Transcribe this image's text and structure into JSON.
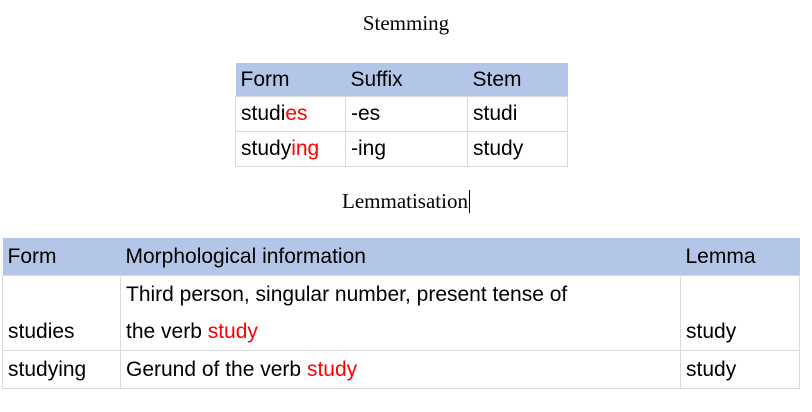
{
  "stemming": {
    "heading": "Stemming",
    "columns": [
      "Form",
      "Suffix",
      "Stem"
    ],
    "rows": [
      {
        "form_base": "studi",
        "form_suffix": "es",
        "suffix": "-es",
        "stem": "studi"
      },
      {
        "form_base": "study",
        "form_suffix": "ing",
        "suffix": "-ing",
        "stem": "study"
      }
    ]
  },
  "lemmatisation": {
    "heading": "Lemmatisation",
    "columns": [
      "Form",
      "Morphological information",
      "Lemma"
    ],
    "rows": [
      {
        "form": "studies",
        "info_line1": "Third person, singular number, present tense of",
        "info_line2_prefix": "the verb ",
        "info_highlight": "study",
        "lemma": "study"
      },
      {
        "form": "studying",
        "info_line1": "",
        "info_line2_prefix": "Gerund of the verb ",
        "info_highlight": "study",
        "lemma": "study"
      }
    ]
  },
  "colors": {
    "header_fill": "#b4c6e7",
    "highlight": "#ff0000",
    "grid": "#d9d9d9"
  }
}
